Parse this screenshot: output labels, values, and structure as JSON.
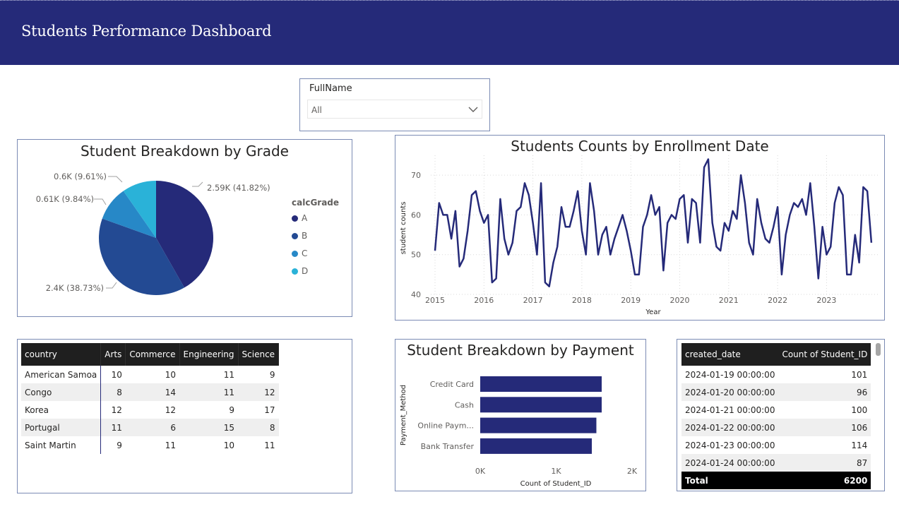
{
  "header": {
    "title": "Students Performance Dashboard",
    "background": "#252a79"
  },
  "slicer": {
    "title": "FullName",
    "value": "All",
    "icon": "chevron-down-icon"
  },
  "pie": {
    "title": "Student Breakdown by Grade",
    "legend_title": "calcGrade",
    "labels": [
      "2.59K (41.82%)",
      "2.4K (38.73%)",
      "0.61K (9.84%)",
      "0.6K (9.61%)"
    ],
    "legend": [
      "A",
      "B",
      "C",
      "D"
    ]
  },
  "line": {
    "title": "Students Counts by Enrollment Date",
    "xlabel": "Year",
    "ylabel": "student counts",
    "yticks": [
      "70",
      "60",
      "50",
      "40"
    ],
    "xticks": [
      "2015",
      "2016",
      "2017",
      "2018",
      "2019",
      "2020",
      "2021",
      "2022",
      "2023"
    ]
  },
  "bar": {
    "title": "Student Breakdown by Payment",
    "xlabel": "Count of Student_ID",
    "ylabel": "Payment_Method",
    "categories": [
      "Credit Card",
      "Cash",
      "Online Paym...",
      "Bank Transfer"
    ],
    "xticks": [
      "0K",
      "1K",
      "2K"
    ]
  },
  "matrix": {
    "headers": [
      "country",
      "Arts",
      "Commerce",
      "Engineering",
      "Science"
    ],
    "rows": [
      [
        "American Samoa",
        "10",
        "10",
        "11",
        "9"
      ],
      [
        "Congo",
        "8",
        "14",
        "11",
        "12"
      ],
      [
        "Korea",
        "12",
        "12",
        "9",
        "17"
      ],
      [
        "Portugal",
        "11",
        "6",
        "15",
        "8"
      ],
      [
        "Saint Martin",
        "9",
        "11",
        "10",
        "11"
      ]
    ]
  },
  "table": {
    "headers": [
      "created_date",
      "Count of Student_ID"
    ],
    "rows": [
      [
        "2024-01-19 00:00:00",
        "101"
      ],
      [
        "2024-01-20 00:00:00",
        "96"
      ],
      [
        "2024-01-21 00:00:00",
        "100"
      ],
      [
        "2024-01-22 00:00:00",
        "106"
      ],
      [
        "2024-01-23 00:00:00",
        "114"
      ],
      [
        "2024-01-24 00:00:00",
        "87"
      ]
    ],
    "total_label": "Total",
    "total_value": "6200"
  },
  "chart_data": [
    {
      "type": "pie",
      "title": "Student Breakdown by Grade",
      "legend_title": "calcGrade",
      "categories": [
        "A",
        "B",
        "C",
        "D"
      ],
      "values": [
        2590,
        2400,
        610,
        600
      ],
      "percents": [
        41.82,
        38.73,
        9.84,
        9.61
      ],
      "colors": [
        "#252a79",
        "#234a93",
        "#2788c7",
        "#2ab2d8"
      ],
      "legend_position": "right"
    },
    {
      "type": "line",
      "title": "Students Counts by Enrollment Date",
      "xlabel": "Year",
      "ylabel": "student counts",
      "ylim": [
        40,
        75
      ],
      "grid": true,
      "color": "#252a79",
      "x_start": "2015-01",
      "x_step": "month",
      "values": [
        51,
        63,
        60,
        60,
        54,
        61,
        47,
        49,
        56,
        65,
        66,
        61,
        58,
        60,
        43,
        44,
        64,
        54,
        50,
        53,
        61,
        62,
        68,
        65,
        58,
        50,
        68,
        43,
        42,
        48,
        52,
        62,
        57,
        57,
        61,
        66,
        56,
        50,
        68,
        61,
        50,
        55,
        57,
        50,
        54,
        57,
        60,
        56,
        51,
        45,
        45,
        57,
        60,
        65,
        60,
        62,
        46,
        58,
        60,
        59,
        64,
        65,
        53,
        64,
        63,
        53,
        72,
        74,
        58,
        52,
        51,
        58,
        56,
        61,
        59,
        70,
        63,
        53,
        50,
        64,
        58,
        54,
        53,
        57,
        62,
        45,
        55,
        60,
        63,
        62,
        64,
        60,
        68,
        57,
        44,
        57,
        50,
        52,
        63,
        67,
        65,
        45,
        45,
        55,
        48,
        67,
        66,
        53
      ]
    },
    {
      "type": "bar",
      "orientation": "horizontal",
      "title": "Student Breakdown by Payment",
      "categories": [
        "Credit Card",
        "Cash",
        "Online Paym...",
        "Bank Transfer"
      ],
      "values": [
        1600,
        1600,
        1530,
        1470
      ],
      "xlabel": "Count of Student_ID",
      "ylabel": "Payment_Method",
      "xlim": [
        0,
        2000
      ],
      "color": "#252a79"
    }
  ]
}
